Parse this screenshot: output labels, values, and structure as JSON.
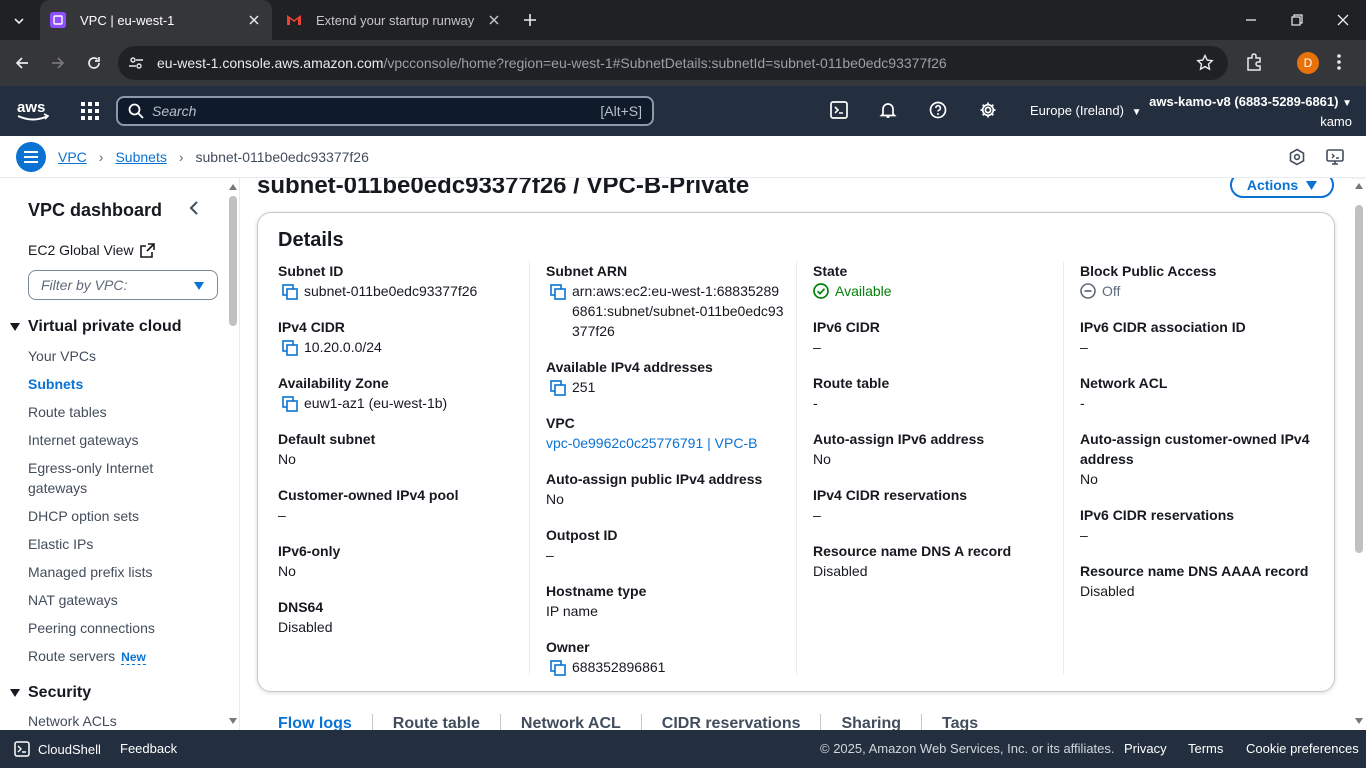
{
  "browser": {
    "tabs": [
      {
        "title": "VPC | eu-west-1",
        "active": true
      },
      {
        "title": "Extend your startup runway – A",
        "active": false
      }
    ],
    "url": {
      "host": "eu-west-1.console.aws.amazon.com",
      "path": "/vpcconsole/home?region=eu-west-1#SubnetDetails:subnetId=subnet-011be0edc93377f26"
    },
    "profile_initial": "D"
  },
  "awsnav": {
    "search_placeholder": "Search",
    "search_shortcut": "[Alt+S]",
    "region": "Europe (Ireland)",
    "account": "aws-kamo-v8 (6883-5289-6861)",
    "user": "kamo"
  },
  "breadcrumb": {
    "vpc": "VPC",
    "subnets": "Subnets",
    "current": "subnet-011be0edc93377f26"
  },
  "sidebar": {
    "title": "VPC dashboard",
    "global_view": "EC2 Global View",
    "filter_placeholder": "Filter by VPC:",
    "section_vpc": "Virtual private cloud",
    "items": [
      {
        "label": "Your VPCs"
      },
      {
        "label": "Subnets",
        "active": true
      },
      {
        "label": "Route tables"
      },
      {
        "label": "Internet gateways"
      },
      {
        "label": "Egress-only Internet gateways"
      },
      {
        "label": "DHCP option sets"
      },
      {
        "label": "Elastic IPs"
      },
      {
        "label": "Managed prefix lists"
      },
      {
        "label": "NAT gateways"
      },
      {
        "label": "Peering connections"
      },
      {
        "label": "Route servers",
        "badge": "New"
      }
    ],
    "section_security": "Security",
    "security_items": [
      {
        "label": "Network ACLs"
      }
    ]
  },
  "main": {
    "title": "subnet-011be0edc93377f26 / VPC-B-Private",
    "actions_label": "Actions",
    "details_heading": "Details",
    "col1": {
      "subnet_id_label": "Subnet ID",
      "subnet_id": "subnet-011be0edc93377f26",
      "ipv4_cidr_label": "IPv4 CIDR",
      "ipv4_cidr": "10.20.0.0/24",
      "az_label": "Availability Zone",
      "az": "euw1-az1 (eu-west-1b)",
      "default_label": "Default subnet",
      "default": "No",
      "coip_label": "Customer-owned IPv4 pool",
      "coip": "–",
      "ipv6only_label": "IPv6-only",
      "ipv6only": "No",
      "dns64_label": "DNS64",
      "dns64": "Disabled"
    },
    "col2": {
      "arn_label": "Subnet ARN",
      "arn": "arn:aws:ec2:eu-west-1:688352896861:subnet/subnet-011be0edc93377f26",
      "avail_label": "Available IPv4 addresses",
      "avail": "251",
      "vpc_label": "VPC",
      "vpc": "vpc-0e9962c0c25776791 | VPC-B",
      "autopub_label": "Auto-assign public IPv4 address",
      "autopub": "No",
      "outpost_label": "Outpost ID",
      "outpost": "–",
      "hostname_label": "Hostname type",
      "hostname": "IP name",
      "owner_label": "Owner",
      "owner": "688352896861"
    },
    "col3": {
      "state_label": "State",
      "state": "Available",
      "ipv6cidr_label": "IPv6 CIDR",
      "ipv6cidr": "–",
      "rt_label": "Route table",
      "rt": "-",
      "autov6_label": "Auto-assign IPv6 address",
      "autov6": "No",
      "v4res_label": "IPv4 CIDR reservations",
      "v4res": "–",
      "dnsa_label": "Resource name DNS A record",
      "dnsa": "Disabled"
    },
    "col4": {
      "bpa_label": "Block Public Access",
      "bpa": "Off",
      "v6assoc_label": "IPv6 CIDR association ID",
      "v6assoc": "–",
      "nacl_label": "Network ACL",
      "nacl": "-",
      "autocoip_label": "Auto-assign customer-owned IPv4 address",
      "autocoip": "No",
      "v6res_label": "IPv6 CIDR reservations",
      "v6res": "–",
      "dnsaaaa_label": "Resource name DNS AAAA record",
      "dnsaaaa": "Disabled"
    },
    "tabs": [
      "Flow logs",
      "Route table",
      "Network ACL",
      "CIDR reservations",
      "Sharing",
      "Tags"
    ]
  },
  "footer": {
    "cloudshell": "CloudShell",
    "feedback": "Feedback",
    "copyright": "© 2025, Amazon Web Services, Inc. or its affiliates.",
    "privacy": "Privacy",
    "terms": "Terms",
    "cookies": "Cookie preferences"
  }
}
